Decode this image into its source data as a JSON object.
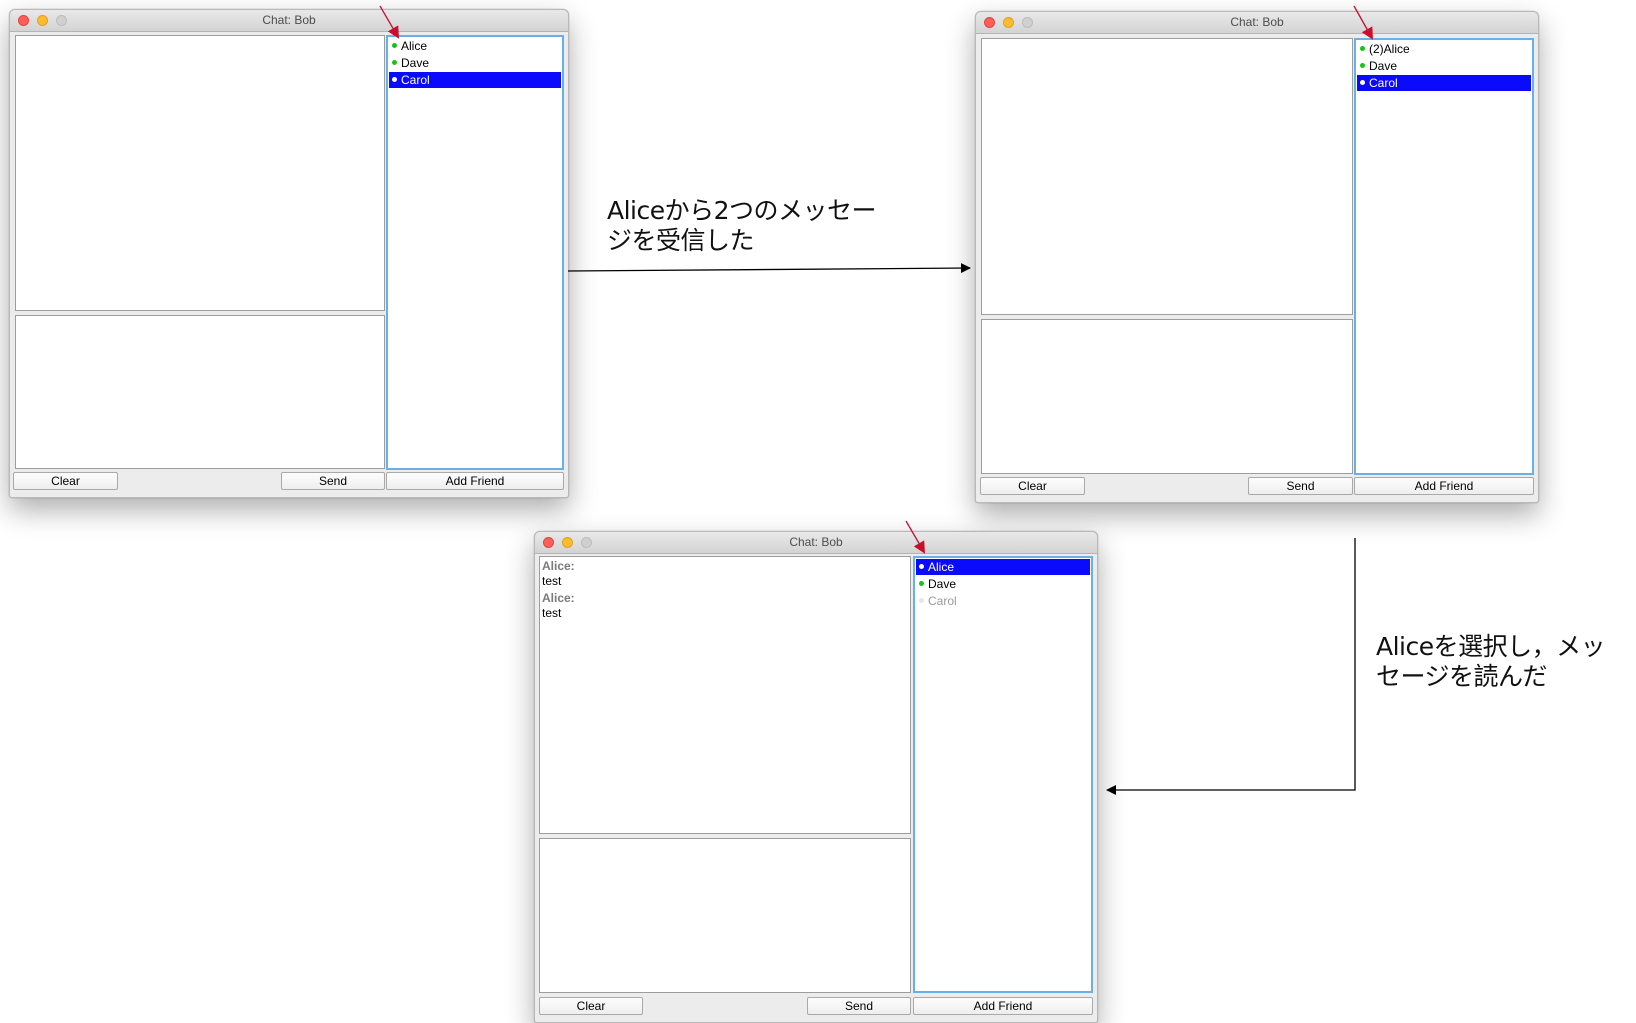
{
  "windows": [
    {
      "title": "Chat: Bob",
      "friends": [
        {
          "label": "Alice",
          "status": "online",
          "selected": false
        },
        {
          "label": "Dave",
          "status": "online",
          "selected": false
        },
        {
          "label": "Carol",
          "status": "online",
          "selected": true
        }
      ],
      "messages": [],
      "clear_label": "Clear",
      "send_label": "Send",
      "add_friend_label": "Add Friend"
    },
    {
      "title": "Chat: Bob",
      "friends": [
        {
          "label": "(2)Alice",
          "status": "online",
          "selected": false
        },
        {
          "label": "Dave",
          "status": "online",
          "selected": false
        },
        {
          "label": "Carol",
          "status": "online",
          "selected": true
        }
      ],
      "messages": [],
      "clear_label": "Clear",
      "send_label": "Send",
      "add_friend_label": "Add Friend"
    },
    {
      "title": "Chat: Bob",
      "friends": [
        {
          "label": "Alice",
          "status": "online",
          "selected": true
        },
        {
          "label": "Dave",
          "status": "online",
          "selected": false
        },
        {
          "label": "Carol",
          "status": "offline",
          "selected": false
        }
      ],
      "messages": [
        {
          "sender": "Alice:",
          "text": "test"
        },
        {
          "sender": "Alice:",
          "text": "test"
        }
      ],
      "clear_label": "Clear",
      "send_label": "Send",
      "add_friend_label": "Add Friend"
    }
  ],
  "captions": {
    "received_line1": "Aliceから2つのメッセー",
    "received_line2": "ジを受信した",
    "selected_line1": "Aliceを選択し，メッ",
    "selected_line2": "セージを読んだ"
  },
  "colors": {
    "selection": "#0a0afc",
    "online_dot": "#19c219",
    "pointer_arrow": "#c8102e",
    "flow_arrow": "#000000"
  }
}
